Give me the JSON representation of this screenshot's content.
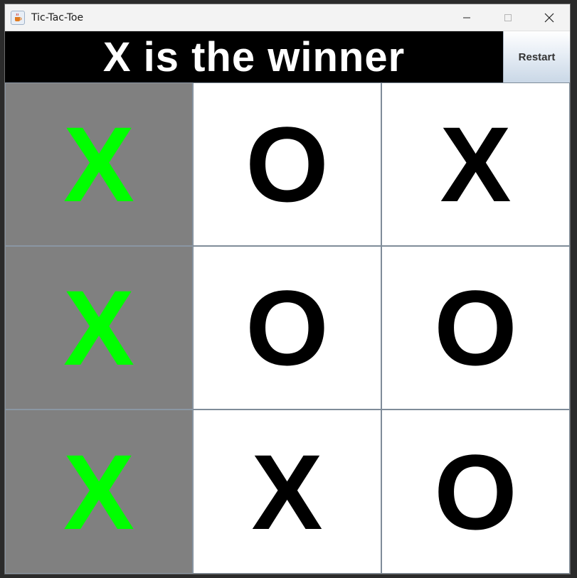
{
  "window": {
    "title": "Tic-Tac-Toe",
    "controls": [
      "minimize",
      "maximize",
      "close"
    ]
  },
  "status": {
    "text": "X is the winner"
  },
  "restart": {
    "label": "Restart"
  },
  "board": {
    "winning_line": [
      0,
      3,
      6
    ],
    "cells": [
      "X",
      "O",
      "X",
      "X",
      "O",
      "O",
      "X",
      "X",
      "O"
    ]
  },
  "colors": {
    "win_background": "#808080",
    "win_text": "#00ff00",
    "status_background": "#000000",
    "status_text": "#ffffff"
  }
}
